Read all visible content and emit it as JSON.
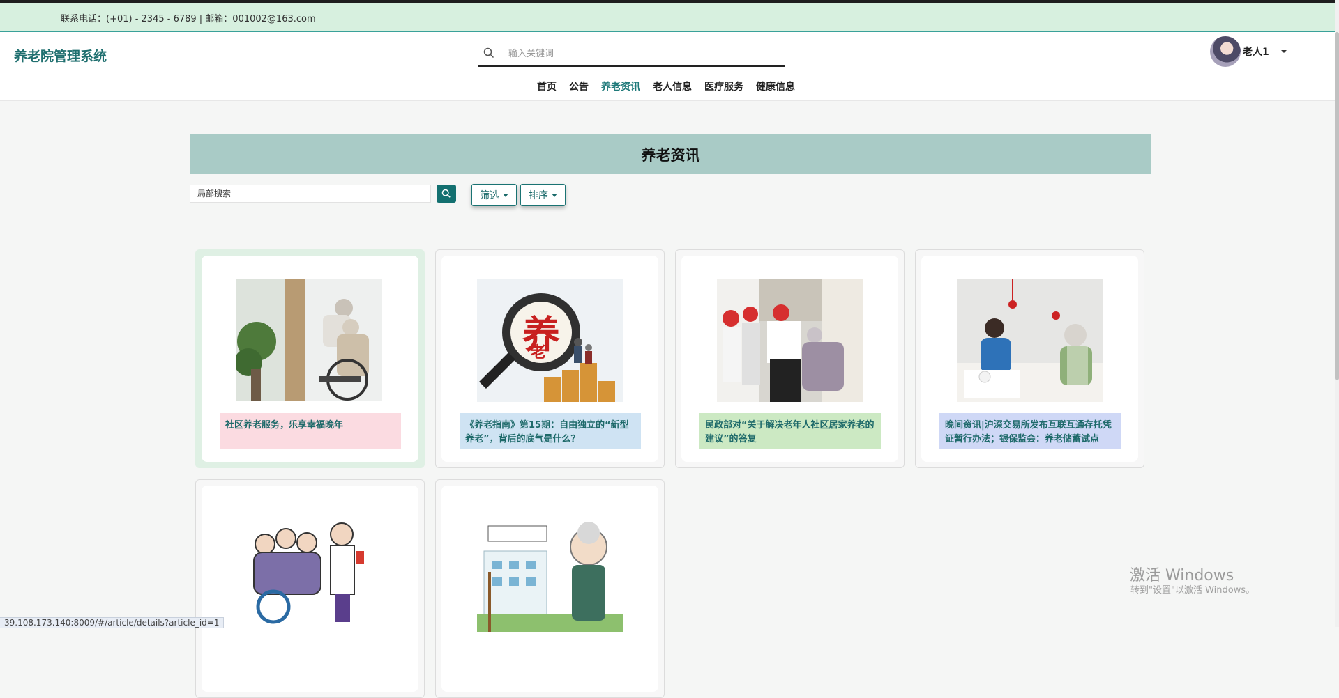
{
  "contact": {
    "text": "联系电话：(+01) - 2345 - 6789 | 邮箱：001002@163.com"
  },
  "header": {
    "brand": "养老院管理系统",
    "search_placeholder": "输入关键词",
    "user_name": "老人1"
  },
  "nav": {
    "items": [
      "首页",
      "公告",
      "养老资讯",
      "老人信息",
      "医疗服务",
      "健康信息"
    ],
    "active": "养老资讯"
  },
  "main": {
    "banner_title": "养老资讯",
    "local_search_placeholder": "局部搜索",
    "filter_label": "筛选",
    "sort_label": "排序"
  },
  "articles": [
    {
      "title": "社区养老服务，乐享幸福晚年"
    },
    {
      "title": "《养老指南》第15期：自由独立的“新型养老”，背后的底气是什么？"
    },
    {
      "title": "民政部对“关于解决老年人社区居家养老的建议”的答复"
    },
    {
      "title": "晚间资讯|沪深交易所发布互联互通存托凭证暂行办法；银保监会：养老储蓄试点"
    },
    {
      "title": ""
    },
    {
      "title": ""
    }
  ],
  "status_url": "39.108.173.140:8009/#/article/details?article_id=1",
  "watermark": {
    "line1": "激活 Windows",
    "line2": "转到\"设置\"以激活 Windows。"
  },
  "colors": {
    "accent": "#1f7a7a",
    "banner": "#a9cbc6",
    "contact_bar": "#d7f0df"
  }
}
